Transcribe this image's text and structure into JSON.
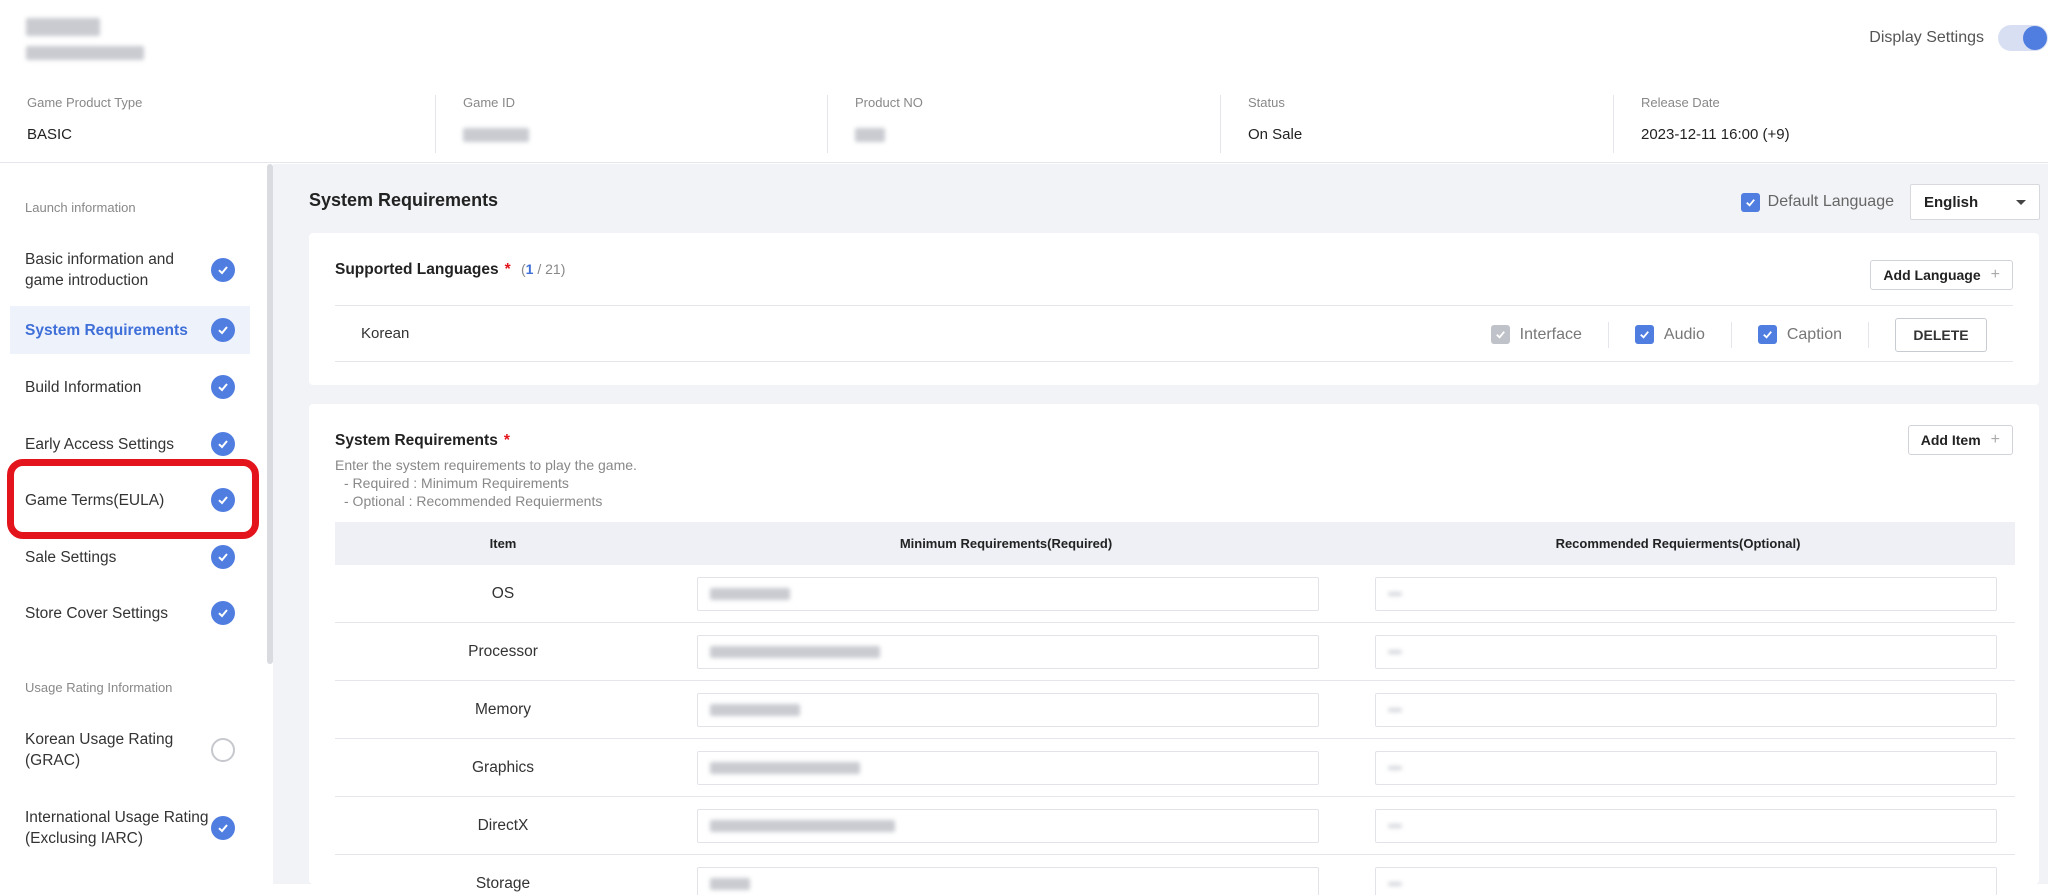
{
  "header": {
    "display_settings_label": "Display Settings",
    "display_settings_on": true
  },
  "meta": [
    {
      "label": "Game Product Type",
      "value": "BASIC"
    },
    {
      "label": "Game ID",
      "value": ""
    },
    {
      "label": "Product NO",
      "value": ""
    },
    {
      "label": "Status",
      "value": "On Sale"
    },
    {
      "label": "Release Date",
      "value": "2023-12-11 16:00 (+9)"
    }
  ],
  "sidebar": {
    "section1_title": "Launch information",
    "section2_title": "Usage Rating Information",
    "items": [
      {
        "label": "Basic information and game introduction",
        "done": true
      },
      {
        "label": "System Requirements",
        "done": true,
        "active": true
      },
      {
        "label": "Build Information",
        "done": true
      },
      {
        "label": "Early Access Settings",
        "done": true
      },
      {
        "label": "Game Terms(EULA)",
        "done": true
      },
      {
        "label": "Sale Settings",
        "done": true
      },
      {
        "label": "Store Cover Settings",
        "done": true
      },
      {
        "label": "Korean Usage Rating (GRAC)",
        "done": false
      },
      {
        "label": "International Usage Rating (Exclusing IARC)",
        "done": true
      }
    ]
  },
  "main": {
    "title": "System Requirements",
    "default_language_label": "Default Language",
    "language_select": "English",
    "supported_languages": {
      "title": "Supported Languages",
      "required_mark": "*",
      "count_current": "1",
      "count_total": "/ 21",
      "add_button": "Add Language",
      "rows": [
        {
          "name": "Korean",
          "interface_label": "Interface",
          "audio_label": "Audio",
          "caption_label": "Caption",
          "delete_label": "DELETE"
        }
      ]
    },
    "system_requirements": {
      "title": "System Requirements",
      "required_mark": "*",
      "add_button": "Add Item",
      "desc_line1": "Enter the system requirements to play the game.",
      "desc_line2": "- Required : Minimum Requirements",
      "desc_line3": "- Optional : Recommended Requierments",
      "columns": [
        "Item",
        "Minimum Requirements(Required)",
        "Recommended Requierments(Optional)"
      ],
      "rows": [
        {
          "item": "OS"
        },
        {
          "item": "Processor"
        },
        {
          "item": "Memory"
        },
        {
          "item": "Graphics"
        },
        {
          "item": "DirectX"
        },
        {
          "item": "Storage"
        }
      ]
    }
  },
  "colors": {
    "accent": "#4f7de0",
    "highlight": "#e3141c",
    "required": "#e3141c"
  },
  "icons": [
    "check-icon",
    "plus-icon",
    "chevron-down-icon"
  ]
}
